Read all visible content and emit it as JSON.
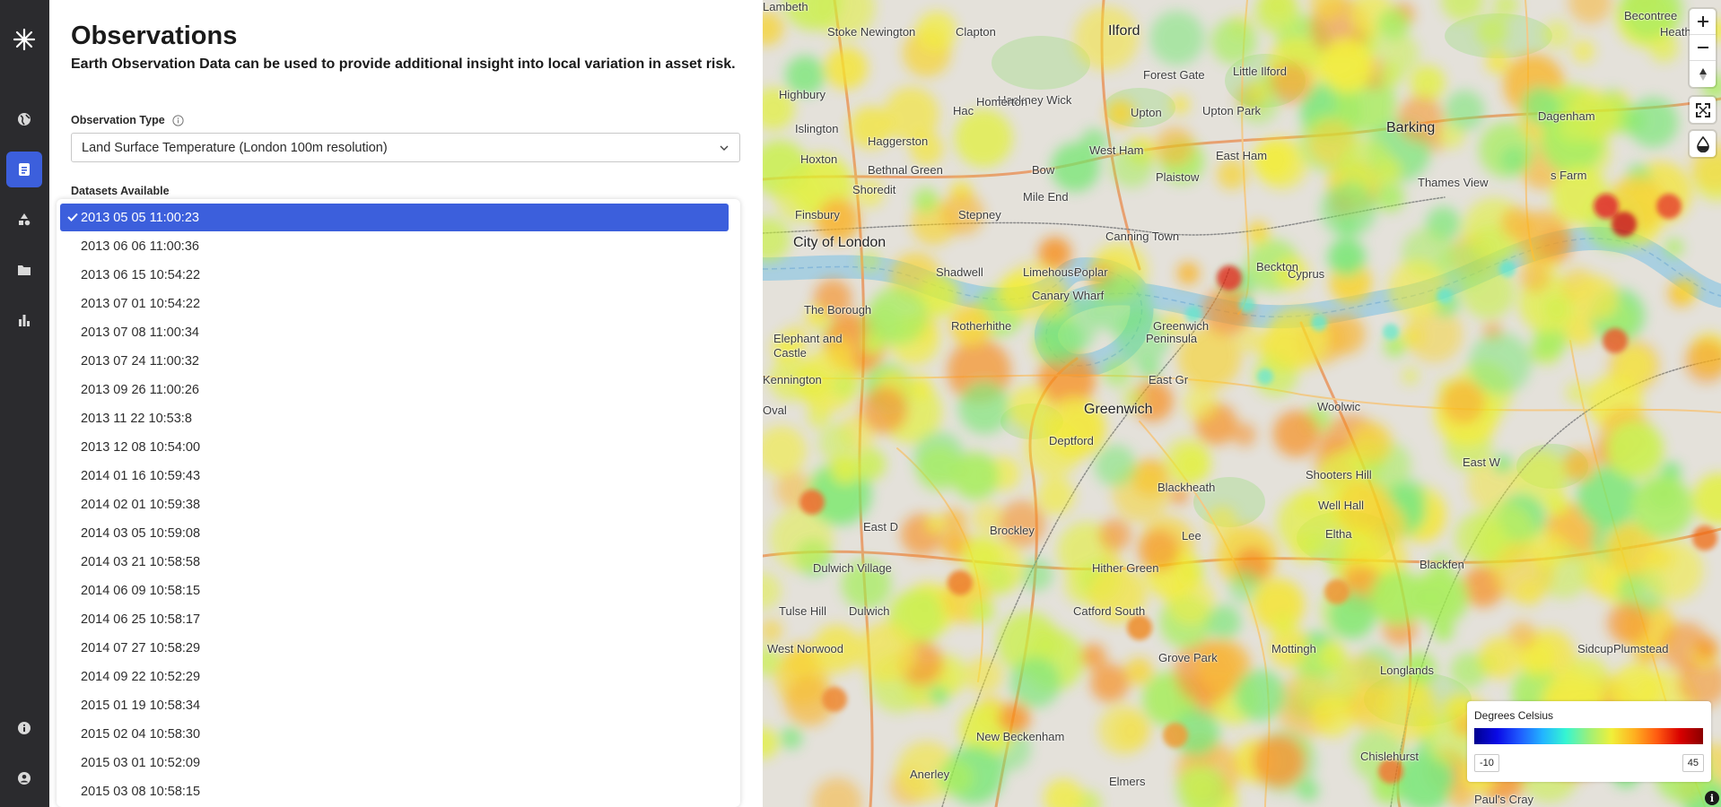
{
  "nav": {
    "items": [
      {
        "icon": "globe-icon"
      },
      {
        "icon": "observations-icon",
        "active": true
      },
      {
        "icon": "shapes-icon"
      },
      {
        "icon": "folder-icon"
      },
      {
        "icon": "bar-chart-icon"
      }
    ],
    "bottom": [
      {
        "icon": "info-icon"
      },
      {
        "icon": "user-icon"
      }
    ]
  },
  "panel": {
    "title": "Observations",
    "subtitle": "Earth Observation Data can be used to provide additional insight into local variation in asset risk.",
    "observation_type_label": "Observation Type",
    "observation_type_value": "Land Surface Temperature (London 100m resolution)",
    "datasets_label": "Datasets Available",
    "datasets": [
      "2013 05 05 11:00:23",
      "2013 06 06 11:00:36",
      "2013 06 15 10:54:22",
      "2013 07 01 10:54:22",
      "2013 07 08 11:00:34",
      "2013 07 24 11:00:32",
      "2013 09 26 11:00:26",
      "2013 11 22 10:53:8",
      "2013 12 08 10:54:00",
      "2014 01 16 10:59:43",
      "2014 02 01 10:59:38",
      "2014 03 05 10:59:08",
      "2014 03 21 10:58:58",
      "2014 06 09 10:58:15",
      "2014 06 25 10:58:17",
      "2014 07 27 10:58:29",
      "2014 09 22 10:52:29",
      "2015 01 19 10:58:34",
      "2015 02 04 10:58:30",
      "2015 03 01 10:52:09",
      "2015 03 08 10:58:15"
    ],
    "selected_index": 0
  },
  "map": {
    "places": [
      {
        "name": "Stoke Newington"
      },
      {
        "name": "Clapton"
      },
      {
        "name": "Ilford"
      },
      {
        "name": "Becontree"
      },
      {
        "name": "Heath"
      },
      {
        "name": "Hackney Wick"
      },
      {
        "name": "Homerton"
      },
      {
        "name": "Forest Gate"
      },
      {
        "name": "Little Ilford"
      },
      {
        "name": "Highbury"
      },
      {
        "name": "Hac"
      },
      {
        "name": "Upton"
      },
      {
        "name": "Upton Park"
      },
      {
        "name": "Barking"
      },
      {
        "name": "Dagenham"
      },
      {
        "name": "Islington"
      },
      {
        "name": "Haggerston"
      },
      {
        "name": "West Ham"
      },
      {
        "name": "East Ham"
      },
      {
        "name": "Hoxton"
      },
      {
        "name": "Bethnal Green"
      },
      {
        "name": "Bow"
      },
      {
        "name": "Plaistow"
      },
      {
        "name": "Thames View"
      },
      {
        "name": "s Farm"
      },
      {
        "name": "Shoredit"
      },
      {
        "name": "Mile End"
      },
      {
        "name": "Finsbury"
      },
      {
        "name": "Stepney"
      },
      {
        "name": "Canning Town"
      },
      {
        "name": "Beckton"
      },
      {
        "name": "City of London"
      },
      {
        "name": "Shadwell"
      },
      {
        "name": "Limehouse"
      },
      {
        "name": "Poplar"
      },
      {
        "name": "Canary Wharf"
      },
      {
        "name": "Cyprus"
      },
      {
        "name": "The Borough"
      },
      {
        "name": "Elephant and"
      },
      {
        "name": "Castle"
      },
      {
        "name": "Rotherhithe"
      },
      {
        "name": "Greenwich"
      },
      {
        "name": "Peninsula"
      },
      {
        "name": "Kennington"
      },
      {
        "name": "East Gr"
      },
      {
        "name": "Oval"
      },
      {
        "name": "Greenwich"
      },
      {
        "name": "Woolwic"
      },
      {
        "name": "Deptford"
      },
      {
        "name": "Shooters Hill"
      },
      {
        "name": "East W"
      },
      {
        "name": "Blackheath"
      },
      {
        "name": "Lee"
      },
      {
        "name": "Well Hall"
      },
      {
        "name": "East D"
      },
      {
        "name": "Brockley"
      },
      {
        "name": "Eltha"
      },
      {
        "name": "Blackfen"
      },
      {
        "name": "Dulwich Village"
      },
      {
        "name": "Hither Green"
      },
      {
        "name": "Tulse Hill"
      },
      {
        "name": "Dulwich"
      },
      {
        "name": "Catford South"
      },
      {
        "name": "West Norwood"
      },
      {
        "name": "Grove Park"
      },
      {
        "name": "Mottingh"
      },
      {
        "name": "Longlands"
      },
      {
        "name": "Sidcup"
      },
      {
        "name": "New Beckenham"
      },
      {
        "name": "Chislehurst"
      },
      {
        "name": "Anerley"
      },
      {
        "name": "Elmers"
      },
      {
        "name": "Paul's Cray"
      },
      {
        "name": "Plumstead"
      },
      {
        "name": "Lambeth"
      }
    ],
    "legend": {
      "title": "Degrees Celsius",
      "min": "-10",
      "max": "45"
    }
  }
}
